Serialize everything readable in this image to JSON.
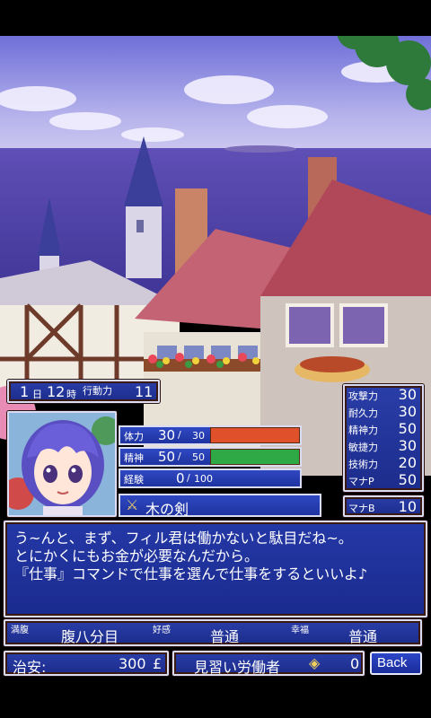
{
  "time": {
    "day": "1",
    "day_unit": "日",
    "hour": "12",
    "hour_unit": "時",
    "action_label": "行動力",
    "action_value": "11"
  },
  "status": {
    "hp": {
      "label": "体力",
      "current": "30",
      "max": "30",
      "fraction": 1.0,
      "color": "#e0502a"
    },
    "mp": {
      "label": "精神",
      "current": "50",
      "max": "50",
      "fraction": 1.0,
      "color": "#2fa846"
    },
    "exp": {
      "label": "経験",
      "current": "0",
      "max": "100",
      "fraction": 0.0,
      "color": "#2a3ea8"
    },
    "slash": "/"
  },
  "equipment": {
    "weapon": "木の剣",
    "icon": "sword-icon"
  },
  "attributes": [
    {
      "label": "攻撃力",
      "value": "30"
    },
    {
      "label": "耐久力",
      "value": "30"
    },
    {
      "label": "精神力",
      "value": "50"
    },
    {
      "label": "敏捷力",
      "value": "30"
    },
    {
      "label": "技術力",
      "value": "20"
    },
    {
      "label": "マナP",
      "value": "50"
    }
  ],
  "mana_b": {
    "label": "マナB",
    "value": "10"
  },
  "message": {
    "lines": [
      "う~んと、まず、フィル君は働かないと駄目だね~。",
      "とにかくにもお金が必要なんだから。",
      "『仕事』コマンドで仕事を選んで仕事をするといいよ♪"
    ]
  },
  "mood": {
    "hunger_label": "満腹",
    "hunger_value": "腹八分目",
    "favor_label": "好感",
    "favor_value": "普通",
    "happy_label": "幸福",
    "happy_value": "普通"
  },
  "bottom": {
    "security_label": "治安:",
    "security_value": "300",
    "currency": "£",
    "rank": "見習い労働者",
    "medal_icon": "medal-icon",
    "medal_count": "0",
    "back_label": "Back"
  }
}
